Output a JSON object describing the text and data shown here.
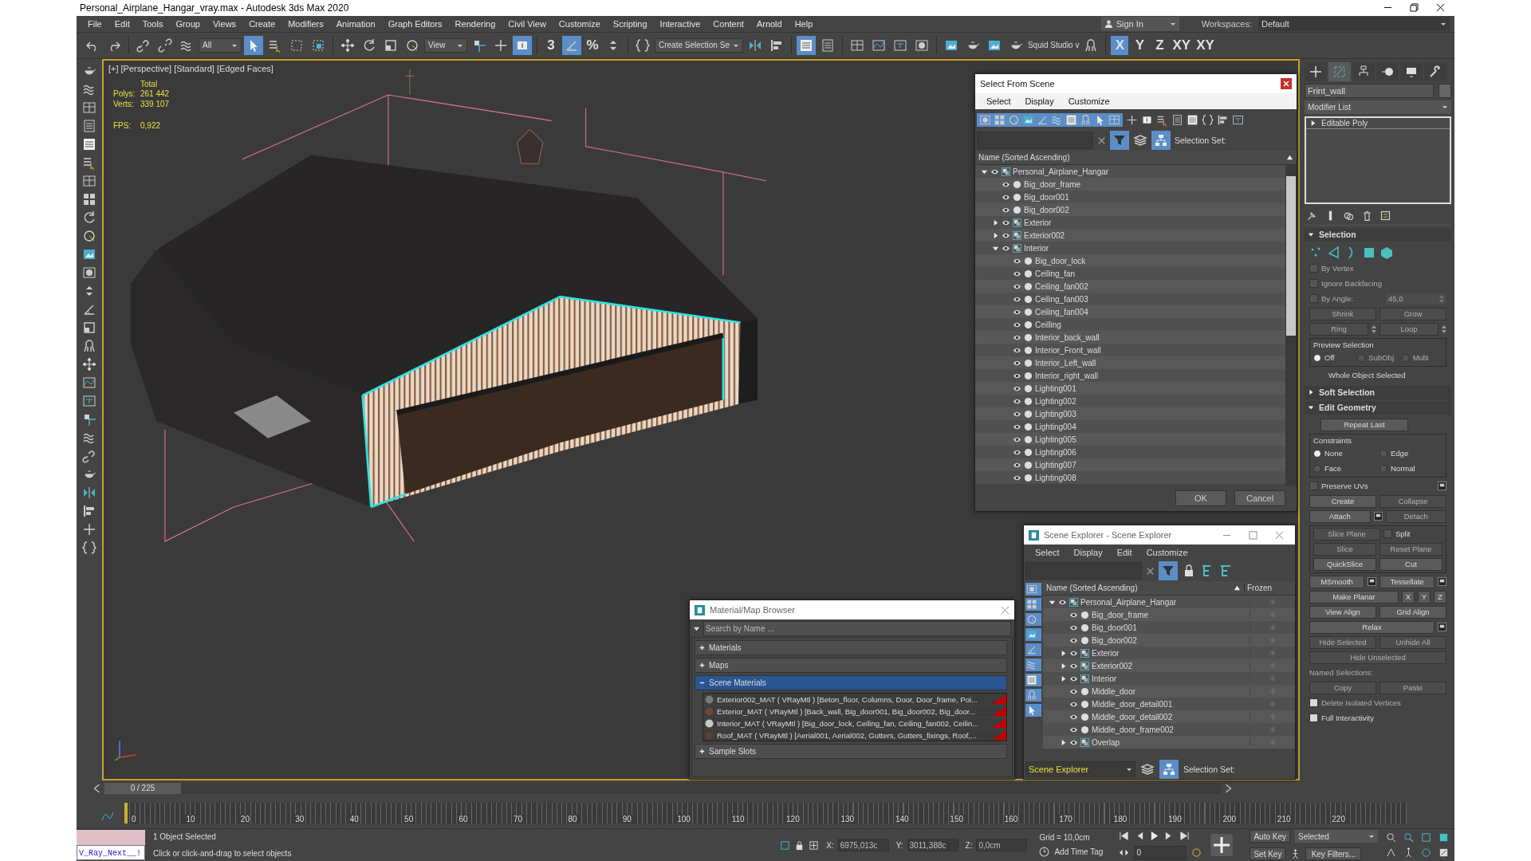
{
  "window": {
    "title": "Personal_Airplane_Hangar_vray.max - Autodesk 3ds Max 2020"
  },
  "menu": [
    "File",
    "Edit",
    "Tools",
    "Group",
    "Views",
    "Create",
    "Modifiers",
    "Animation",
    "Graph Editors",
    "Rendering",
    "Civil View",
    "Customize",
    "Scripting",
    "Interactive",
    "Content",
    "Arnold",
    "Help"
  ],
  "account": {
    "sign_in": "Sign In",
    "workspaces_label": "Workspaces:",
    "workspace": "Default"
  },
  "main_toolbar": [
    {
      "kind": "icon",
      "selected": false
    },
    {
      "kind": "icon",
      "selected": false
    },
    {
      "kind": "sep"
    },
    {
      "kind": "icon",
      "selected": false
    },
    {
      "kind": "icon",
      "selected": false
    },
    {
      "kind": "icon",
      "selected": false
    },
    {
      "kind": "dropdown",
      "value": "All"
    },
    {
      "kind": "icon",
      "selected": true
    },
    {
      "kind": "icon",
      "selected": false
    },
    {
      "kind": "icon",
      "selected": false
    },
    {
      "kind": "icon",
      "selected": false
    },
    {
      "kind": "sep"
    },
    {
      "kind": "icon",
      "selected": false
    },
    {
      "kind": "icon",
      "selected": false
    },
    {
      "kind": "icon",
      "selected": false
    },
    {
      "kind": "icon",
      "selected": false
    },
    {
      "kind": "dropdown",
      "value": "View"
    },
    {
      "kind": "icon",
      "selected": false
    },
    {
      "kind": "icon",
      "selected": false
    },
    {
      "kind": "icon",
      "selected": true
    },
    {
      "kind": "sep"
    },
    {
      "kind": "glyph",
      "label": "3",
      "selected": false
    },
    {
      "kind": "icon",
      "selected": true
    },
    {
      "kind": "glyph",
      "label": "%",
      "selected": false
    },
    {
      "kind": "icon",
      "selected": false
    },
    {
      "kind": "sep"
    },
    {
      "kind": "icon",
      "selected": false
    },
    {
      "kind": "dropdown",
      "value": "Create Selection Se"
    },
    {
      "kind": "icon",
      "selected": false
    },
    {
      "kind": "icon",
      "selected": false
    },
    {
      "kind": "sep"
    },
    {
      "kind": "icon",
      "selected": true
    },
    {
      "kind": "icon",
      "selected": false
    },
    {
      "kind": "sep"
    },
    {
      "kind": "icon",
      "selected": false
    },
    {
      "kind": "icon",
      "selected": false
    },
    {
      "kind": "icon",
      "selected": false
    },
    {
      "kind": "icon",
      "selected": false
    },
    {
      "kind": "sep"
    },
    {
      "kind": "icon",
      "selected": false
    },
    {
      "kind": "icon",
      "selected": false
    },
    {
      "kind": "icon",
      "selected": false
    },
    {
      "kind": "icon",
      "selected": false
    },
    {
      "kind": "text",
      "label": "Squid Studio v"
    },
    {
      "kind": "icon",
      "selected": false
    },
    {
      "kind": "sep"
    },
    {
      "kind": "glyph",
      "label": "X",
      "selected": true
    },
    {
      "kind": "glyph",
      "label": "Y",
      "selected": false
    },
    {
      "kind": "glyph",
      "label": "Z",
      "selected": false
    },
    {
      "kind": "glyph",
      "label": "XY",
      "selected": false
    },
    {
      "kind": "glyph",
      "label": "XY",
      "selected": false
    }
  ],
  "viewport": {
    "labels": [
      "[+]",
      "[Perspective]",
      "[Standard]",
      "[Edged Faces]"
    ],
    "stats_title": "Total",
    "stats": [
      {
        "label": "Polys:",
        "value": "261 442"
      },
      {
        "label": "Verts:",
        "value": "339 107"
      }
    ],
    "fps_label": "FPS:",
    "fps": "0,922"
  },
  "select_from_scene": {
    "title": "Select From Scene",
    "menu": [
      "Select",
      "Display",
      "Customize"
    ],
    "selection_set_label": "Selection Set:",
    "column": "Name (Sorted Ascending)",
    "tree": [
      {
        "name": "Personal_Airplane_Hangar",
        "kind": "group",
        "expanded": true,
        "children": [
          {
            "name": "Big_door_frame",
            "kind": "object"
          },
          {
            "name": "Big_door001",
            "kind": "object"
          },
          {
            "name": "Big_door002",
            "kind": "object"
          },
          {
            "name": "Exterior",
            "kind": "group",
            "expanded": false
          },
          {
            "name": "Exterior002",
            "kind": "group",
            "expanded": false
          },
          {
            "name": "Interior",
            "kind": "group",
            "expanded": true,
            "children": [
              {
                "name": "Big_door_lock",
                "kind": "object"
              },
              {
                "name": "Ceiling_fan",
                "kind": "object"
              },
              {
                "name": "Ceiling_fan002",
                "kind": "object"
              },
              {
                "name": "Ceiling_fan003",
                "kind": "object"
              },
              {
                "name": "Ceiling_fan004",
                "kind": "object"
              },
              {
                "name": "Ceilling",
                "kind": "object"
              },
              {
                "name": "Interior_back_wall",
                "kind": "object"
              },
              {
                "name": "Interior_Front_wall",
                "kind": "object"
              },
              {
                "name": "Interior_Left_wall",
                "kind": "object"
              },
              {
                "name": "Interior_right_wall",
                "kind": "object"
              },
              {
                "name": "Lighting001",
                "kind": "object"
              },
              {
                "name": "Lighting002",
                "kind": "object"
              },
              {
                "name": "Lighting003",
                "kind": "object"
              },
              {
                "name": "Lighting004",
                "kind": "object"
              },
              {
                "name": "Lighting005",
                "kind": "object"
              },
              {
                "name": "Lighting006",
                "kind": "object"
              },
              {
                "name": "Lighting007",
                "kind": "object"
              },
              {
                "name": "Lighting008",
                "kind": "object"
              }
            ]
          }
        ]
      }
    ],
    "buttons": [
      "OK",
      "Cancel"
    ]
  },
  "scene_explorer": {
    "title": "Scene Explorer - Scene Explorer",
    "menu": [
      "Select",
      "Display",
      "Edit",
      "Customize"
    ],
    "columns": [
      "Name (Sorted Ascending)",
      "Frozen"
    ],
    "tree": [
      {
        "name": "Personal_Airplane_Hangar",
        "kind": "group",
        "expanded": true,
        "children": [
          {
            "name": "Big_door_frame",
            "kind": "object"
          },
          {
            "name": "Big_door001",
            "kind": "object"
          },
          {
            "name": "Big_door002",
            "kind": "object"
          },
          {
            "name": "Exterior",
            "kind": "group",
            "expanded": false
          },
          {
            "name": "Exterior002",
            "kind": "group",
            "expanded": false
          },
          {
            "name": "Interior",
            "kind": "group",
            "expanded": false
          },
          {
            "name": "Middle_door",
            "kind": "object"
          },
          {
            "name": "Middle_door_detail001",
            "kind": "object"
          },
          {
            "name": "Middle_door_detail002",
            "kind": "object"
          },
          {
            "name": "Middle_door_frame002",
            "kind": "object"
          },
          {
            "name": "Overlap",
            "kind": "group",
            "expanded": false
          }
        ]
      }
    ],
    "explorer_name": "Scene Explorer",
    "selection_set_label": "Selection Set:"
  },
  "material_browser": {
    "title": "Material/Map Browser",
    "search": {
      "placeholder": "Search by Name ..."
    },
    "sections": [
      {
        "label": "Materials",
        "expanded": false,
        "selected": false
      },
      {
        "label": "Maps",
        "expanded": false,
        "selected": false
      },
      {
        "label": "Scene Materials",
        "expanded": true,
        "selected": true,
        "items": [
          {
            "text": "Exterior002_MAT ( VRayMtl ) [Beton_floor, Columns, Door, Door_frame, Poi...",
            "color": "#7a7a7a"
          },
          {
            "text": "Exterior_MAT ( VRayMtl ) [Back_wall, Big_door001, Big_door002, Big_door...",
            "color": "#6b4a35"
          },
          {
            "text": "Interior_MAT ( VRayMtl ) [Big_door_lock, Ceiling_fan, Ceiling_fan002, Ceilin...",
            "color": "#c8c8c8"
          },
          {
            "text": "Roof_MAT ( VRayMtl ) [Aerial001, Aerial002, Gutters, Gutters_fixings, Roof,...",
            "color": "#5a4036"
          }
        ]
      },
      {
        "label": "Sample Slots",
        "expanded": false,
        "selected": false
      }
    ]
  },
  "command_panel": {
    "tabs": [
      {
        "selected": false
      },
      {
        "selected": true
      },
      {
        "selected": false
      },
      {
        "selected": false
      },
      {
        "selected": false
      },
      {
        "selected": false
      }
    ],
    "object_name": "Frint_wall",
    "modifier_list": "Modifier List",
    "stack": [
      {
        "label": "Editable Poly",
        "expanded": false
      }
    ],
    "rollouts": [
      {
        "title": "Selection",
        "expanded": true,
        "rows": [
          [
            {
              "kind": "subobject"
            }
          ],
          [
            {
              "kind": "check",
              "label": "By Vertex",
              "checked": false,
              "disabled": true
            }
          ],
          [
            {
              "kind": "check",
              "label": "Ignore Backfacing",
              "checked": false,
              "disabled": true
            }
          ],
          [
            {
              "kind": "check",
              "label": "By Angle:",
              "checked": false,
              "disabled": true
            },
            {
              "kind": "spinner",
              "value": "45,0",
              "disabled": true
            }
          ],
          [
            {
              "kind": "button",
              "label": "Shrink",
              "disabled": true
            },
            {
              "kind": "button",
              "label": "Grow",
              "disabled": true
            }
          ],
          [
            {
              "kind": "spinbutton",
              "label": "Ring",
              "disabled": true
            },
            {
              "kind": "spinbutton",
              "label": "Loop",
              "disabled": true
            }
          ],
          [
            {
              "kind": "group",
              "label": "Preview Selection",
              "rows": [
                [
                  {
                    "kind": "radio",
                    "label": "Off",
                    "selected": true,
                    "disabled": false
                  },
                  {
                    "kind": "radio",
                    "label": "SubObj",
                    "selected": false,
                    "disabled": true
                  },
                  {
                    "kind": "radio",
                    "label": "Multi",
                    "selected": false,
                    "disabled": true
                  }
                ]
              ]
            }
          ],
          [
            {
              "kind": "label",
              "label": "Whole Object Selected",
              "disabled": false
            }
          ]
        ]
      },
      {
        "title": "Soft Selection",
        "expanded": false
      },
      {
        "title": "Edit Geometry",
        "expanded": true,
        "rows": [
          [
            {
              "kind": "widebutton",
              "label": "Repeat Last",
              "disabled": false
            }
          ],
          [
            {
              "kind": "group",
              "label": "Constraints",
              "rows": [
                [
                  {
                    "kind": "radio",
                    "label": "None",
                    "selected": true,
                    "disabled": false
                  },
                  {
                    "kind": "radio",
                    "label": "Edge",
                    "selected": false,
                    "disabled": false
                  }
                ],
                [
                  {
                    "kind": "radio",
                    "label": "Face",
                    "selected": false,
                    "disabled": false
                  },
                  {
                    "kind": "radio",
                    "label": "Normal",
                    "selected": false,
                    "disabled": false
                  }
                ]
              ]
            }
          ],
          [
            {
              "kind": "check",
              "label": "Preserve UVs",
              "checked": false,
              "disabled": false
            },
            {
              "kind": "settings"
            }
          ],
          [
            {
              "kind": "button",
              "label": "Create",
              "disabled": false
            },
            {
              "kind": "button",
              "label": "Collapse",
              "disabled": true
            }
          ],
          [
            {
              "kind": "button",
              "label": "Attach",
              "disabled": false
            },
            {
              "kind": "settings"
            },
            {
              "kind": "button",
              "label": "Detach",
              "disabled": true
            }
          ],
          [
            {
              "kind": "group",
              "rows": [
                [
                  {
                    "kind": "button",
                    "label": "Slice Plane",
                    "disabled": true
                  },
                  {
                    "kind": "check",
                    "label": "Split",
                    "checked": false,
                    "disabled": false
                  }
                ],
                [
                  {
                    "kind": "button",
                    "label": "Slice",
                    "disabled": true
                  },
                  {
                    "kind": "button",
                    "label": "Reset Plane",
                    "disabled": true
                  }
                ],
                [
                  {
                    "kind": "button",
                    "label": "QuickSlice",
                    "disabled": false
                  },
                  {
                    "kind": "button",
                    "label": "Cut",
                    "disabled": false
                  }
                ]
              ]
            }
          ],
          [
            {
              "kind": "button",
              "label": "MSmooth",
              "disabled": false
            },
            {
              "kind": "settings"
            },
            {
              "kind": "button",
              "label": "Tessellate",
              "disabled": false
            },
            {
              "kind": "settings"
            }
          ],
          [
            {
              "kind": "button",
              "label": "Make Planar",
              "disabled": false
            },
            {
              "kind": "axisbutton",
              "label": "X",
              "disabled": false
            },
            {
              "kind": "axisbutton",
              "label": "Y",
              "disabled": false
            },
            {
              "kind": "axisbutton",
              "label": "Z",
              "disabled": false
            }
          ],
          [
            {
              "kind": "button",
              "label": "View Align",
              "disabled": false
            },
            {
              "kind": "button",
              "label": "Grid Align",
              "disabled": false
            }
          ],
          [
            {
              "kind": "button",
              "label": "Relax",
              "disabled": false
            },
            {
              "kind": "settings"
            }
          ],
          [
            {
              "kind": "button",
              "label": "Hide Selected",
              "disabled": true
            },
            {
              "kind": "button",
              "label": "Unhide All",
              "disabled": true
            }
          ],
          [
            {
              "kind": "button",
              "label": "Hide Unselected",
              "disabled": true
            }
          ],
          [
            {
              "kind": "label",
              "label": "Named Selections:",
              "disabled": true
            }
          ],
          [
            {
              "kind": "button",
              "label": "Copy",
              "disabled": true
            },
            {
              "kind": "button",
              "label": "Paste",
              "disabled": true
            }
          ],
          [
            {
              "kind": "check",
              "label": "Delete Isolated Vertices",
              "checked": true,
              "disabled": true
            }
          ],
          [
            {
              "kind": "check",
              "label": "Full Interactivity",
              "checked": true,
              "disabled": false
            }
          ]
        ]
      }
    ]
  },
  "timeline": {
    "frame": "0 / 225",
    "level": 0,
    "ticks": [
      "0",
      "10",
      "20",
      "30",
      "40",
      "50",
      "60",
      "70",
      "80",
      "90",
      "100",
      "110",
      "120",
      "130",
      "140",
      "150",
      "160",
      "170",
      "180",
      "190",
      "200",
      "210",
      "220"
    ]
  },
  "status": {
    "listener": "V_Ray_Next__!",
    "selected": "1 Object Selected",
    "prompt": "Click or click-and-drag to select objects",
    "coords": [
      {
        "label": "X:",
        "value": "6975,013c"
      },
      {
        "label": "Y:",
        "value": "3011,388c"
      },
      {
        "label": "Z:",
        "value": "0,0cm"
      }
    ],
    "grid": "Grid = 10,0cm",
    "time_tag": "Add Time Tag",
    "frame": "0",
    "auto_key": "Auto Key",
    "set_key": "Set Key",
    "key_mode": "Selected",
    "key_filters": "Key Filters..."
  }
}
